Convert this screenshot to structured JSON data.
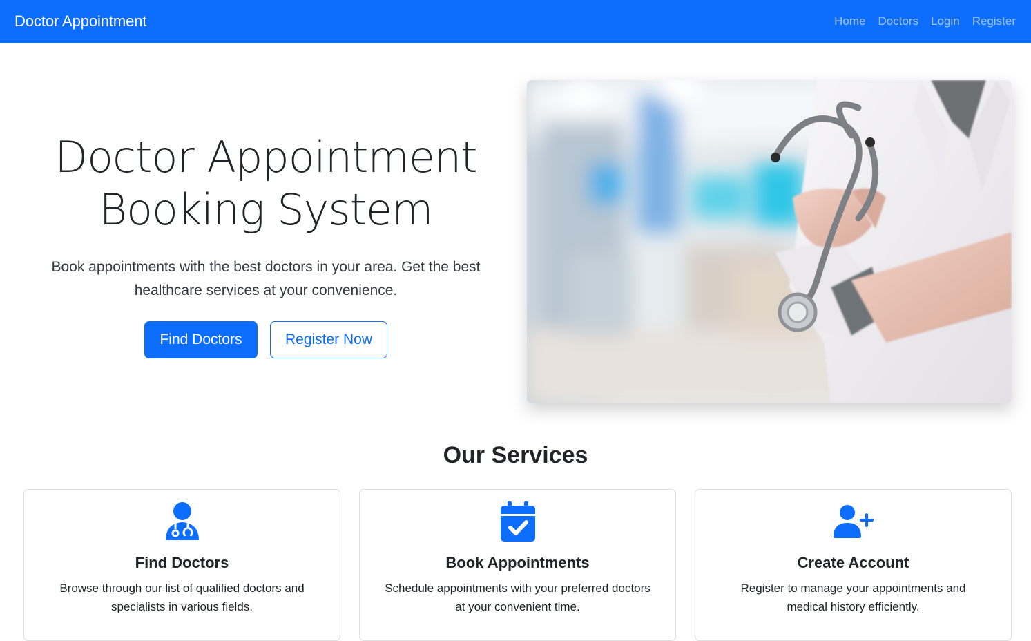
{
  "navbar": {
    "brand": "Doctor Appointment",
    "links": [
      {
        "label": "Home"
      },
      {
        "label": "Doctors"
      },
      {
        "label": "Login"
      },
      {
        "label": "Register"
      }
    ]
  },
  "hero": {
    "title_line1": "Doctor Appointment",
    "title_line2": "Booking System",
    "lead": "Book appointments with the best doctors in your area. Get the best healthcare services at your convenience.",
    "primary_button": "Find Doctors",
    "secondary_button": "Register Now",
    "image_description_icon": "doctor-with-stethoscope-image"
  },
  "services": {
    "title": "Our Services",
    "cards": [
      {
        "icon": "doctor-icon",
        "title": "Find Doctors",
        "text": "Browse through our list of qualified doctors and specialists in various fields."
      },
      {
        "icon": "calendar-check-icon",
        "title": "Book Appointments",
        "text": "Schedule appointments with your preferred doctors at your convenient time."
      },
      {
        "icon": "user-plus-icon",
        "title": "Create Account",
        "text": "Register to manage your appointments and medical history efficiently."
      }
    ]
  },
  "colors": {
    "primary": "#0d6efd",
    "text": "#212529",
    "border": "#d9dde1"
  }
}
